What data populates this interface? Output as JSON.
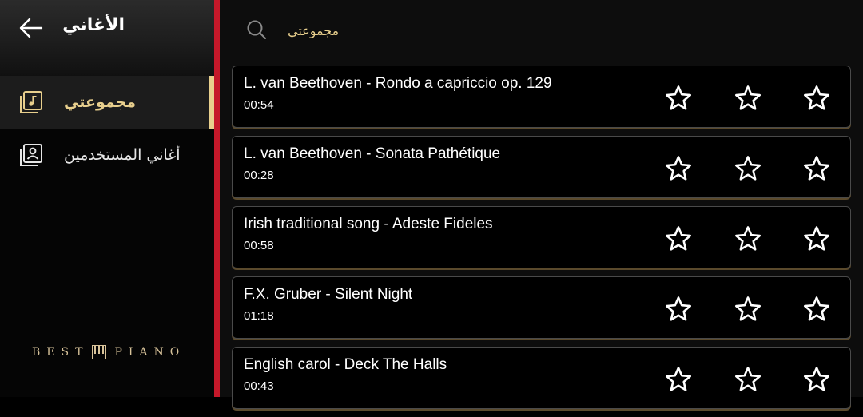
{
  "header": {
    "title": "الأغاني",
    "back_icon": "arrow-left-icon"
  },
  "sidebar": {
    "items": [
      {
        "label": "مجموعتي",
        "icon": "music-collection-icon",
        "active": true
      },
      {
        "label": "أغاني المستخدمين",
        "icon": "user-songs-icon",
        "active": false
      }
    ],
    "logo": {
      "left": "BEST",
      "right": "PIANO"
    }
  },
  "search": {
    "value": "مجموعتي"
  },
  "songs": [
    {
      "title": "L. van Beethoven - Rondo a capriccio op. 129",
      "duration": "00:54",
      "stars": 0
    },
    {
      "title": "L. van Beethoven - Sonata Pathétique",
      "duration": "00:28",
      "stars": 0
    },
    {
      "title": "Irish traditional song - Adeste Fideles",
      "duration": "00:58",
      "stars": 0
    },
    {
      "title": "F.X. Gruber - Silent Night",
      "duration": "01:18",
      "stars": 0
    },
    {
      "title": "English carol - Deck The Halls",
      "duration": "00:43",
      "stars": 0
    }
  ],
  "colors": {
    "accent": "#e8cf8d",
    "divider": "#c5182a",
    "background": "#000000"
  }
}
